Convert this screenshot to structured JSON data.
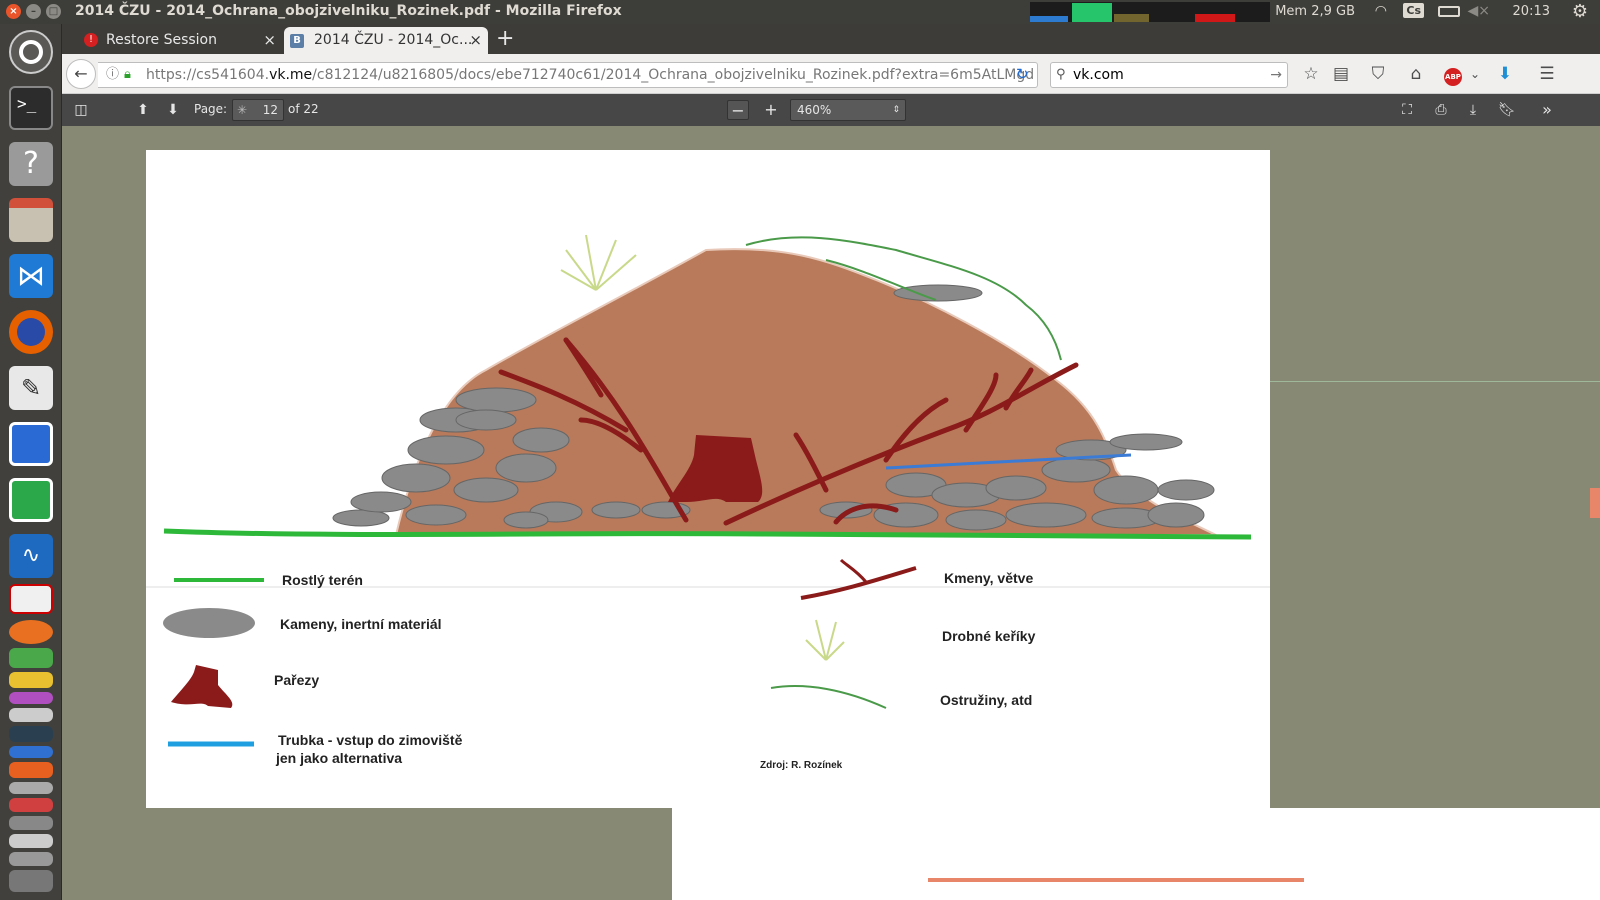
{
  "window": {
    "title": "2014 ČZU - 2014_Ochrana_obojzivelniku_Rozinek.pdf - Mozilla Firefox"
  },
  "indicators": {
    "memory": "Mem 2,9 GB",
    "keyboard": "Cs",
    "clock": "20:13"
  },
  "tabs": [
    {
      "label": "Restore Session"
    },
    {
      "label": "2014 ČZU - 2014_Oc..."
    }
  ],
  "urlbar": {
    "url_prefix": "https://cs541604.",
    "url_domain": "vk.me",
    "url_rest": "/c812124/u8216805/docs/ebe712740c61/2014_Ochrana_obojzivelniku_Rozinek.pdf?extra=6m5AtLMgd"
  },
  "search": {
    "value": "vk.com"
  },
  "pdf_toolbar": {
    "page_label": "Page:",
    "page_number": "12",
    "page_count": "of 22",
    "zoom": "460%"
  },
  "legend": {
    "terrain": "Rostlý terén",
    "stones": "Kameny, inertní materiál",
    "stumps": "Pařezy",
    "pipe_line1": "Trubka - vstup do zimoviště",
    "pipe_line2": "jen jako alternativa",
    "branches": "Kmeny, větve",
    "shrubs": "Drobné keříky",
    "brambles": "Ostružiny, atd",
    "source": "Zdroj: R. Rozínek"
  },
  "colors": {
    "terrain": "#2eb83a",
    "mound": "#b87a5a",
    "stone": "#8a8a8a",
    "branch": "#8b1a1a",
    "stump": "#8b1a1a",
    "pipe": "#1f9fe0",
    "shrub": "#c8d98a",
    "bramble": "#4a9a4a",
    "viewer_bg": "#878974",
    "firefox_accent": "#e66000",
    "accent_blue": "#1e8fd5"
  }
}
